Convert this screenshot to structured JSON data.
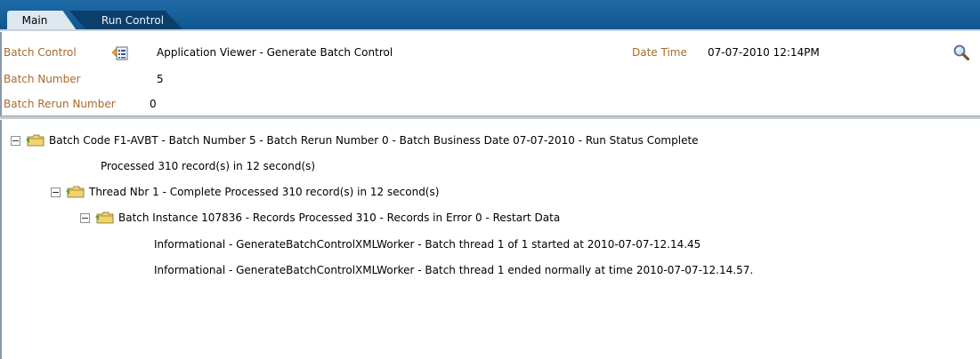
{
  "tabs": [
    {
      "label": "Main"
    },
    {
      "label": "Run Control"
    }
  ],
  "header": {
    "batch_control_label": "Batch Control",
    "batch_control_value": "Application Viewer - Generate Batch Control",
    "date_time_label": "Date Time",
    "date_time_value": "07-07-2010 12:14PM",
    "batch_number_label": "Batch Number",
    "batch_number_value": "5",
    "rerun_label": "Batch Rerun Number",
    "rerun_value": "0"
  },
  "tree": {
    "root": "Batch Code F1-AVBT - Batch Number 5 - Batch Rerun Number 0 - Batch Business Date 07-07-2010 - Run Status Complete",
    "root_detail": "Processed 310 record(s) in 12 second(s)",
    "thread": "Thread Nbr 1 - Complete Processed 310 record(s) in 12 second(s)",
    "instance": "Batch Instance 107836 - Records Processed 310 - Records in Error 0 - Restart Data",
    "messages": [
      "Informational - GenerateBatchControlXMLWorker - Batch thread 1 of 1 started at 2010-07-07-12.14.45",
      "Informational - GenerateBatchControlXMLWorker - Batch thread 1 ended normally at time 2010-07-07-12.14.57."
    ]
  },
  "icons": {
    "batch_control": "list-lookup-icon",
    "search": "search-icon",
    "folder": "folder-icon",
    "collapse": "collapse-toggle-icon"
  },
  "colors": {
    "tabbar": "#0f568f",
    "label": "#a86a2a",
    "folder": "#e8c040"
  }
}
